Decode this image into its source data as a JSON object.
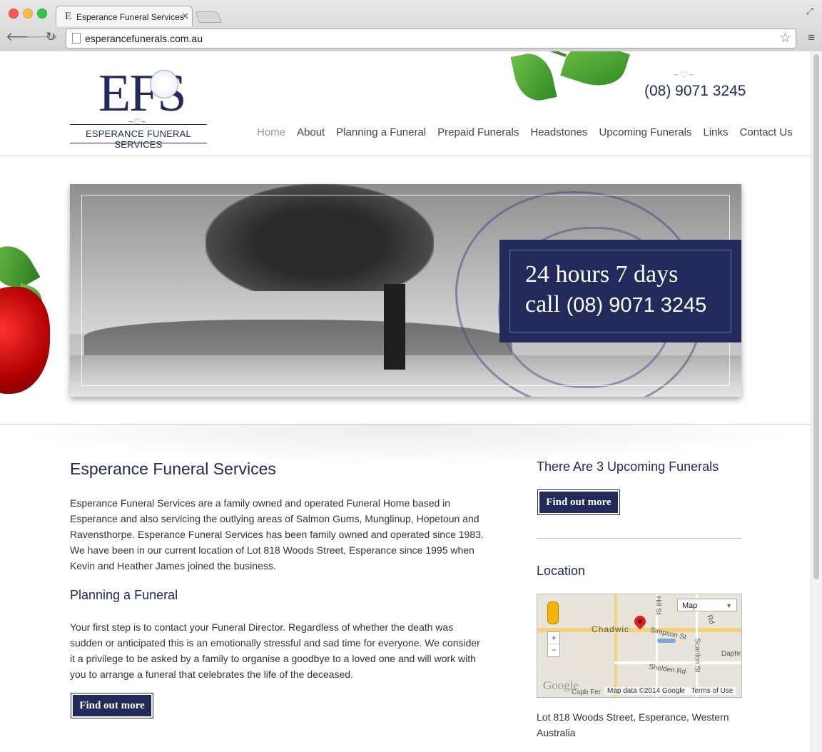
{
  "browser": {
    "tab_title": "Esperance Funeral Services",
    "tab_favicon": "E",
    "url": "esperancefunerals.com.au"
  },
  "header": {
    "logo_letters": "EFS",
    "logo_text": "ESPERANCE FUNERAL SERVICES",
    "phone": "(08) 9071 3245"
  },
  "nav": {
    "items": [
      {
        "label": "Home",
        "active": true
      },
      {
        "label": "About"
      },
      {
        "label": "Planning a Funeral"
      },
      {
        "label": "Prepaid Funerals"
      },
      {
        "label": "Headstones"
      },
      {
        "label": "Upcoming Funerals"
      },
      {
        "label": "Links"
      },
      {
        "label": "Contact Us"
      }
    ]
  },
  "hero": {
    "line1": "24 hours 7 days",
    "line2_prefix": "call",
    "line2_number": "(08) 9071 3245"
  },
  "main": {
    "title": "Esperance Funeral Services",
    "intro": "Esperance Funeral Services are a family owned and operated Funeral Home based in Esperance and also servicing the outlying areas of Salmon Gums, Munglinup, Hopetoun and Ravensthorpe. Esperance Funeral Services has been family owned and operated since 1983. We have been in our current location of Lot 818 Woods Street, Esperance since 1995 when Kevin and Heather James joined the business.",
    "subtitle": "Planning a Funeral",
    "planning_text": "Your first step is to contact your Funeral Director. Regardless of whether the death was sudden or anticipated this is an emotionally stressful and sad time for everyone. We consider it a privilege to be asked by a family to organise a goodbye to a loved one and will work with you to arrange a funeral that celebrates the life of the deceased.",
    "button_label": "Find out more"
  },
  "sidebar": {
    "upcoming_title": "There Are 3 Upcoming Funerals",
    "upcoming_button": "Find out more",
    "location_title": "Location",
    "address": "Lot 818 Woods Street, Esperance, Western Australia",
    "map": {
      "type_label": "Map",
      "labels": {
        "chadwick": "Chadwic",
        "simpson": "Simpson St",
        "shelden": "Shelden Rd",
        "scanlon": "Scanlon St",
        "daphne": "Daphr",
        "hill": "Hill St",
        "road": "Rd",
        "bottom_left": "Cspb Fer"
      },
      "google": "Google",
      "map_data": "Map data ©2014 Google",
      "terms": "Terms of Use",
      "zoom_in": "+",
      "zoom_out": "−"
    }
  },
  "colors": {
    "brand_navy": "#222a5c",
    "nav_active": "#999999"
  }
}
